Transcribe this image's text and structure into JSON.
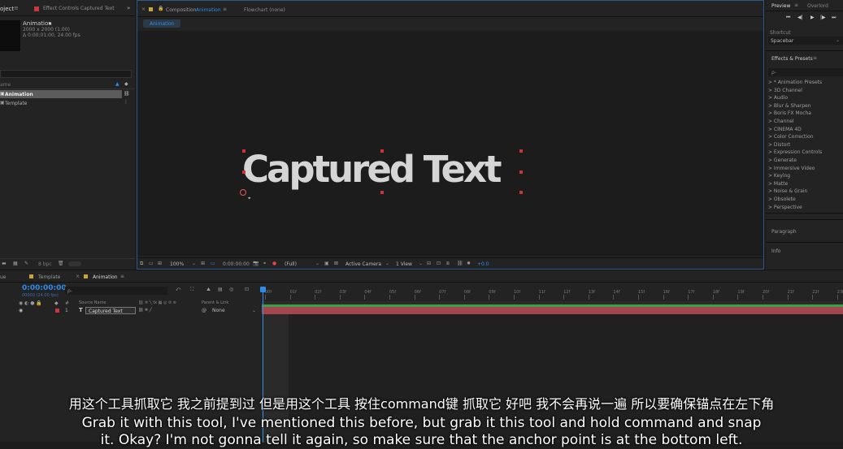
{
  "project_panel": {
    "tab_label": "oject",
    "effect_controls_tab": "Effect Controls Captured Text",
    "comp_name": "Animation",
    "comp_size": "2000 x 2000 (1.00)",
    "comp_duration": "Δ 0:00:01:00, 24.00 fps",
    "col_name": "ame",
    "items": [
      {
        "label": "Animation"
      },
      {
        "label": "Template"
      }
    ],
    "bpc": "8 bpc"
  },
  "composition": {
    "tab_prefix": "Composition",
    "tab_name": "Animation",
    "flowchart_tab": "Flowchart (none)",
    "breadcrumb": "Animation",
    "canvas_text": "Captured Text",
    "footer": {
      "zoom": "100%",
      "timecode": "0:00:00:00",
      "resolution": "(Full)",
      "camera": "Active Camera",
      "views": "1 View",
      "exposure": "+0.0"
    }
  },
  "right_panel": {
    "preview_tab": "Preview",
    "overlord_tab": "Overlord",
    "shortcut_label": "Shortcut",
    "shortcut_value": "Spacebar",
    "effects_title": "Effects & Presets",
    "search_placeholder": "ρ-",
    "effects": [
      "> * Animation Presets",
      "> 3D Channel",
      "> Audio",
      "> Blur & Sharpen",
      "> Boris FX Mocha",
      "> Channel",
      "> CINEMA 4D",
      "> Color Correction",
      "> Distort",
      "> Expression Controls",
      "> Generate",
      "> Immersive Video",
      "> Keying",
      "> Matte",
      "> Noise & Grain",
      "> Obsolete",
      "> Perspective"
    ],
    "paragraph": "Paragraph",
    "info": "Info"
  },
  "timeline": {
    "render_tab": "ue",
    "template_tab": "Template",
    "animation_tab": "Animation",
    "timecode": "0:00:00:00",
    "frame_info": "00000 (24.00 fps)",
    "search_placeholder": "ρ-",
    "columns": {
      "num": "#",
      "source": "Source Name",
      "parent": "Parent & Link"
    },
    "layer": {
      "index": "1",
      "type": "T",
      "name": "Captured Text",
      "parent": "None"
    },
    "ticks": [
      "00f",
      "01f",
      "02f",
      "03f",
      "04f",
      "05f",
      "06f",
      "07f",
      "08f",
      "09f",
      "10f",
      "11f",
      "12f",
      "13f",
      "14f",
      "15f",
      "16f",
      "17f",
      "18f",
      "19f",
      "20f",
      "21f",
      "22f",
      "23f"
    ]
  },
  "subtitles": {
    "line1": "用这个工具抓取它 我之前提到过 但是用这个工具 按住command键 抓取它 好吧 我不会再说一遍 所以要确保锚点在左下角",
    "line2": "Grab it with this tool, I've mentioned this before, but grab it this tool and hold command and snap",
    "line3": "it. Okay? I'm not gonna tell it again, so make sure that the anchor point is at the bottom left."
  }
}
